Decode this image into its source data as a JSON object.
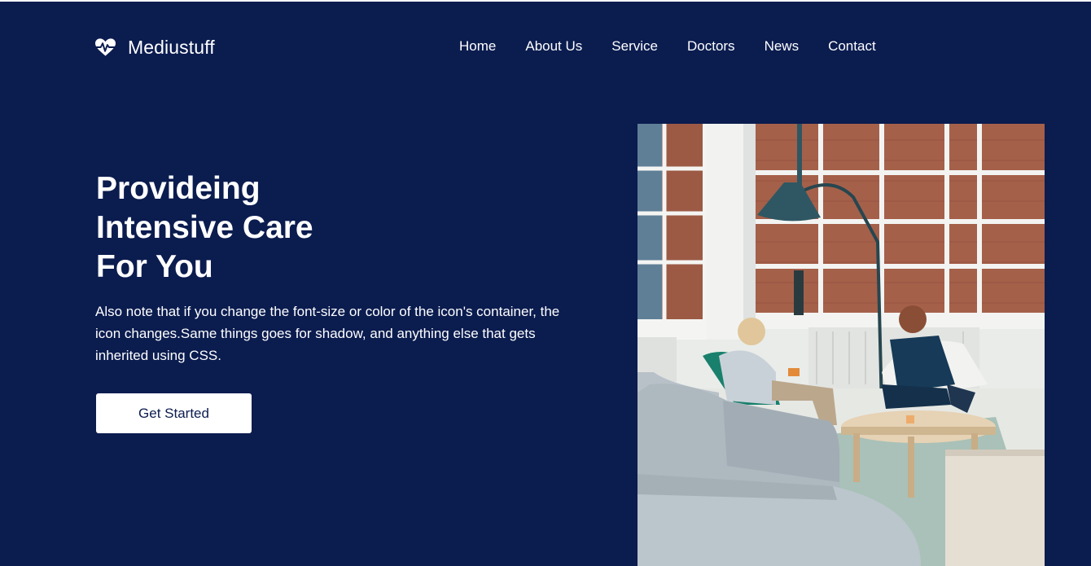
{
  "brand": {
    "name": "Mediustuff",
    "icon": "heart-pulse-icon"
  },
  "nav": {
    "items": [
      {
        "label": "Home"
      },
      {
        "label": "About Us"
      },
      {
        "label": "Service"
      },
      {
        "label": "Doctors"
      },
      {
        "label": "News"
      },
      {
        "label": "Contact"
      }
    ]
  },
  "hero": {
    "title_lines": [
      "Provideing",
      "Intensive Care",
      "For You"
    ],
    "description": "Also note that if you change the font-size or color of the icon's container, the icon changes.Same things goes for shadow, and anything else that gets inherited using CSS.",
    "cta_label": "Get Started"
  },
  "colors": {
    "background": "#0b1c4f",
    "text": "#ffffff",
    "button_bg": "#ffffff",
    "button_text": "#0b1c4f"
  }
}
